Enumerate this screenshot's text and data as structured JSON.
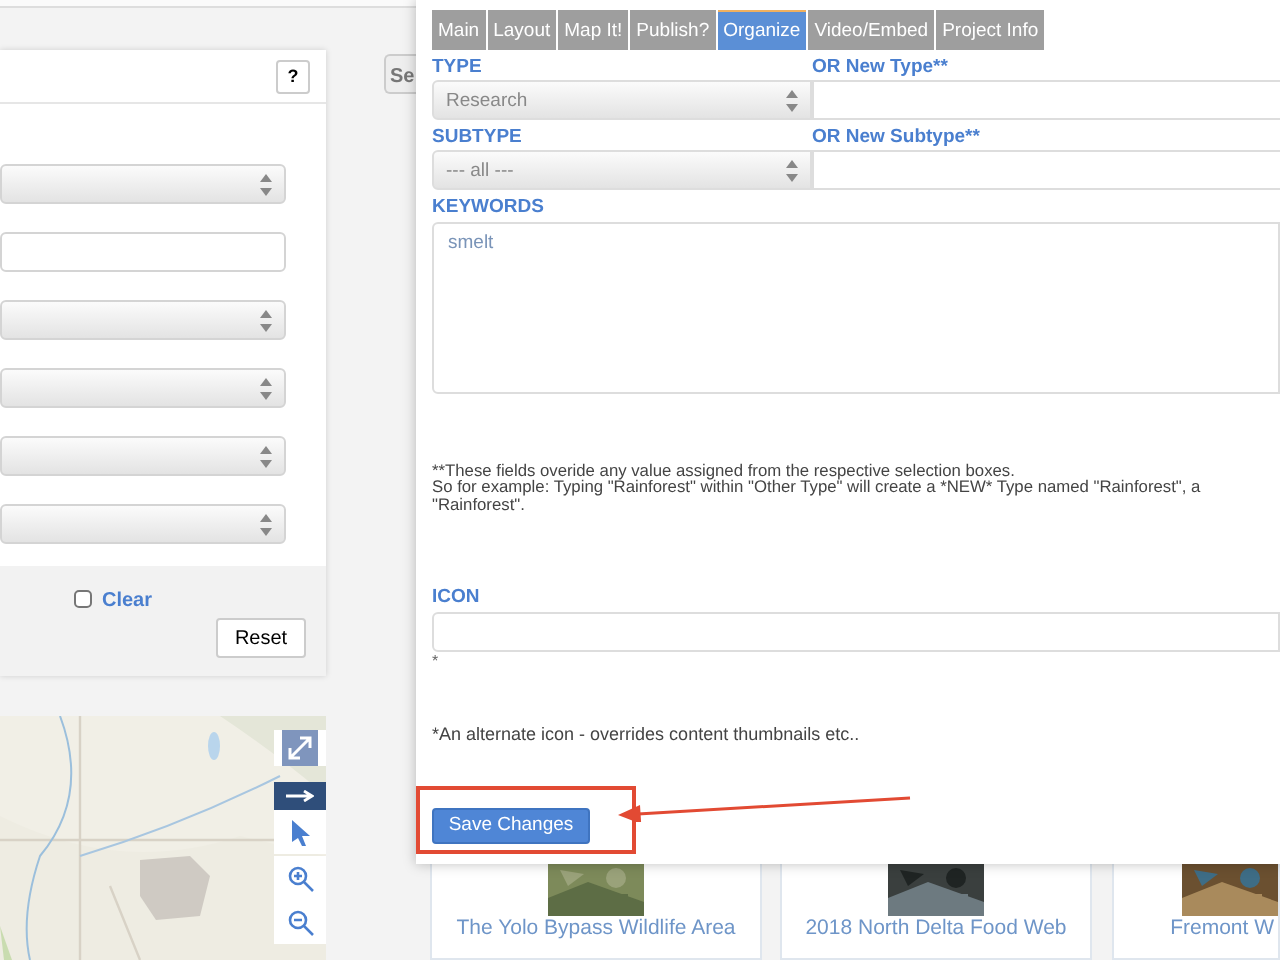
{
  "left_panel": {
    "help_button": "?",
    "filters": [
      {
        "kind": "select"
      },
      {
        "kind": "input"
      },
      {
        "kind": "select"
      },
      {
        "kind": "select"
      },
      {
        "kind": "select"
      },
      {
        "kind": "select"
      }
    ],
    "clear_checkbox": {
      "label": "Clear",
      "checked": false
    },
    "reset_button": "Reset"
  },
  "side_tab": "Se",
  "modal": {
    "tabs": [
      {
        "label": "Main",
        "selected": false
      },
      {
        "label": "Layout",
        "selected": false
      },
      {
        "label": "Map It!",
        "selected": false
      },
      {
        "label": "Publish?",
        "selected": false
      },
      {
        "label": "Organize",
        "selected": true
      },
      {
        "label": "Video/Embed",
        "selected": false
      },
      {
        "label": "Project Info",
        "selected": false
      }
    ],
    "type": {
      "label": "TYPE",
      "value": "Research"
    },
    "new_type": {
      "label": "OR New Type**"
    },
    "subtype": {
      "label": "SUBTYPE",
      "value": "--- all ---"
    },
    "new_subtype": {
      "label": "OR New Subtype**"
    },
    "keywords": {
      "label": "KEYWORDS",
      "value": "smelt"
    },
    "note_lines": [
      "**These fields overide any value assigned from the respective selection boxes.",
      "So for example: Typing \"Rainforest\" within \"Other Type\" will create a *NEW* Type named \"Rainforest\", a",
      "\"Rainforest\"."
    ],
    "icon": {
      "label": "ICON",
      "mark": "*"
    },
    "icon_note": "*An alternate icon - overrides content thumbnails etc..",
    "save_button": "Save Changes"
  },
  "cards": [
    {
      "title_lines": [
        "The Yolo Bypass Wildlife Area"
      ]
    },
    {
      "title_lines": [
        "2018 North Delta Food Web"
      ]
    },
    {
      "title_lines": [
        "Fremont W"
      ]
    }
  ]
}
